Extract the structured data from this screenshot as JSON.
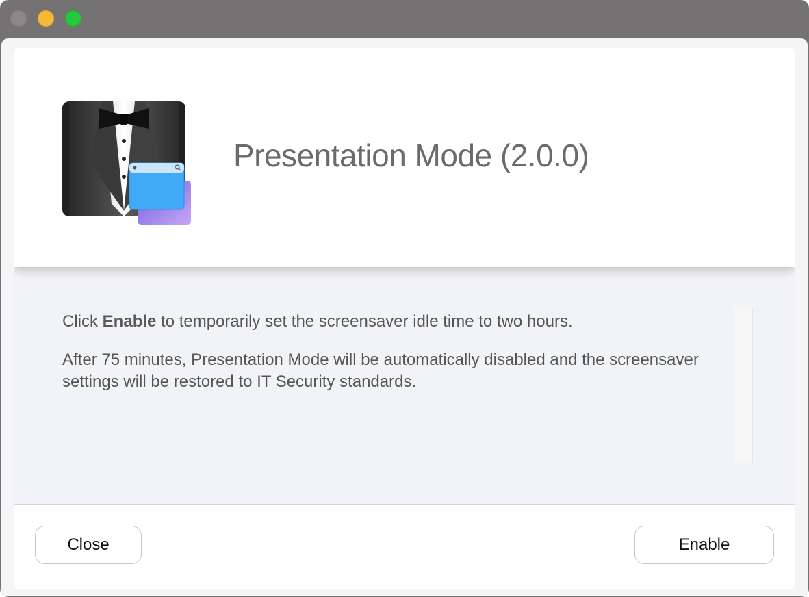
{
  "window": {
    "traffic_lights": [
      "close",
      "minimize",
      "zoom"
    ]
  },
  "header": {
    "app_icon": "tuxedo-presentation-icon",
    "title": "Presentation Mode (2.0.0)"
  },
  "message": {
    "line1_prefix": "Click ",
    "line1_bold": "Enable",
    "line1_suffix": " to temporarily set the screensaver idle time to two hours.",
    "line2": "After 75 minutes, Presentation Mode will be automatically disabled and the screensaver settings will be restored to IT Security standards."
  },
  "buttons": {
    "close_label": "Close",
    "enable_label": "Enable"
  },
  "colors": {
    "traffic_close": "#8a8888",
    "traffic_minimize": "#f7b83a",
    "traffic_zoom": "#27c840",
    "title_text": "#6b6b6b",
    "body_background": "#f2f3f6"
  }
}
